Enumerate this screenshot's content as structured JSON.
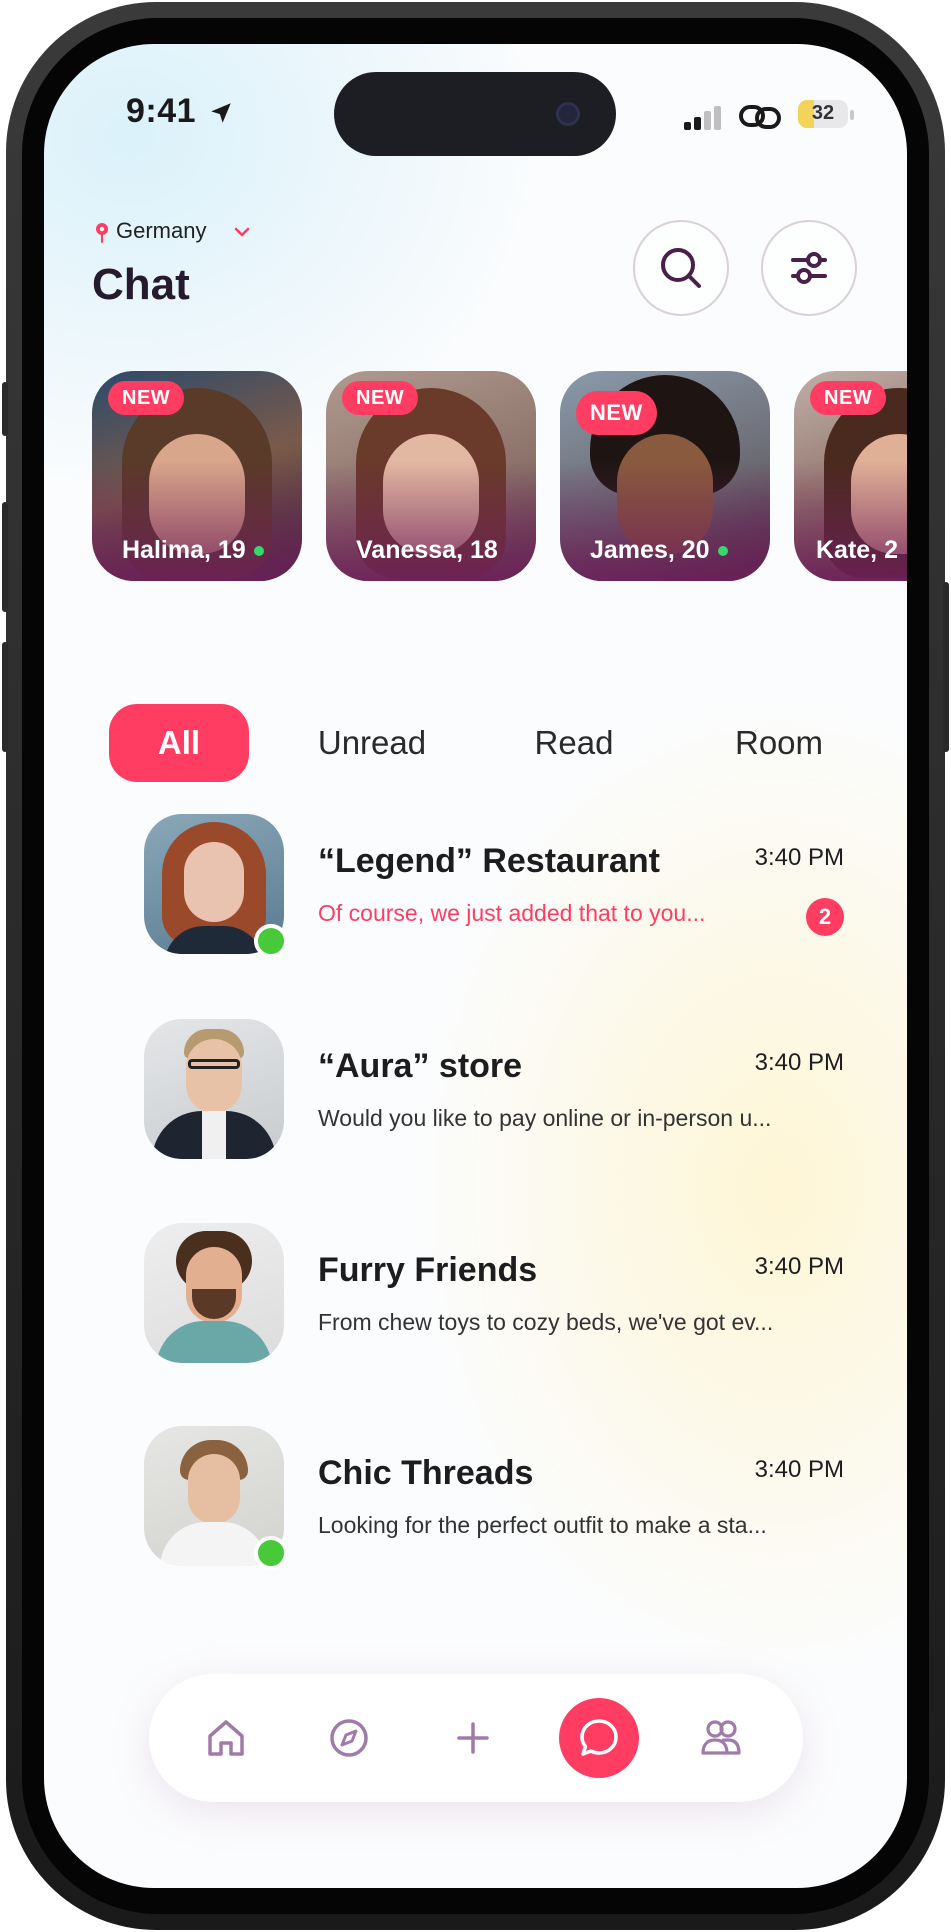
{
  "status_bar": {
    "time": "9:41",
    "battery": "32",
    "battery_level": 0.32
  },
  "header": {
    "location": "Germany",
    "title": "Chat"
  },
  "stories": [
    {
      "badge": "NEW",
      "name": "Halima, 19",
      "online": true
    },
    {
      "badge": "NEW",
      "name": "Vanessa, 18",
      "online": false
    },
    {
      "badge": "NEW",
      "name": "James, 20",
      "online": true
    },
    {
      "badge": "NEW",
      "name": "Kate, 2",
      "online": false
    }
  ],
  "tabs": [
    "All",
    "Unread",
    "Read",
    "Room"
  ],
  "active_tab": "All",
  "chats": [
    {
      "name": "“Legend” Restaurant",
      "time": "3:40 PM",
      "preview": "Of course, we just added that to you...",
      "unread_count": "2",
      "online": true
    },
    {
      "name": "“Aura” store",
      "time": "3:40 PM",
      "preview": "Would you like to pay online or in-person u...",
      "unread_count": "",
      "online": false
    },
    {
      "name": "Furry Friends",
      "time": "3:40 PM",
      "preview": "From chew toys to cozy beds, we've got ev...",
      "unread_count": "",
      "online": false
    },
    {
      "name": "Chic Threads",
      "time": "3:40 PM",
      "preview": "Looking for the perfect outfit to make a sta...",
      "unread_count": "",
      "online": true
    }
  ],
  "bottom_nav": [
    "home-icon",
    "compass-icon",
    "plus-icon",
    "chat-bubble-icon",
    "people-icon"
  ],
  "colors": {
    "accent": "#ff3d63",
    "online": "#47c93a",
    "icon": "#a07aa8",
    "title": "#251a2e"
  }
}
